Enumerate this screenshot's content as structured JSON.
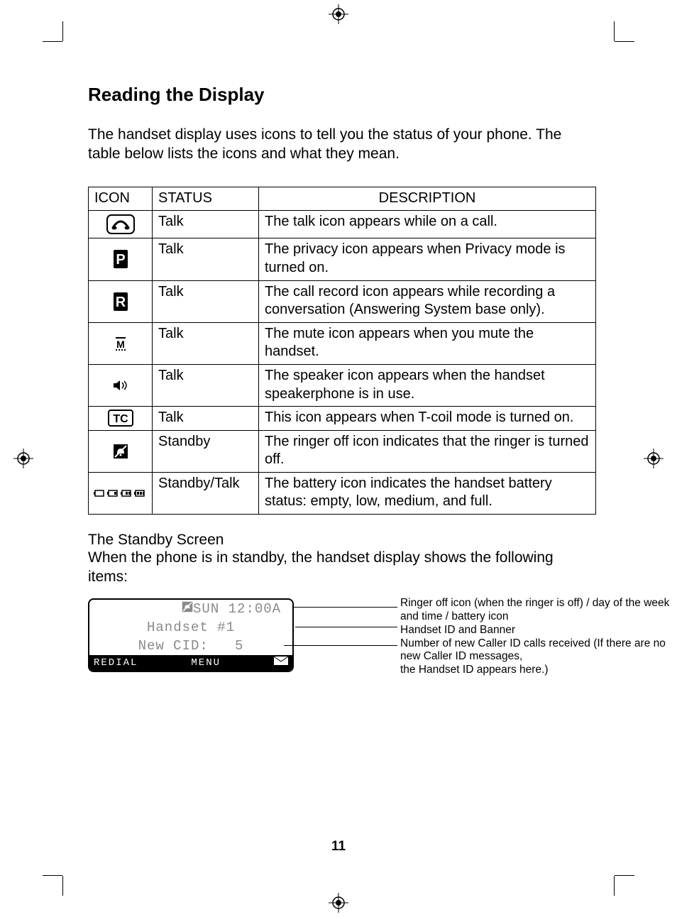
{
  "title": "Reading the Display",
  "intro": "The handset display uses icons to tell you the status of your phone. The table below lists the icons and what they mean.",
  "table": {
    "headers": [
      "ICON",
      "STATUS",
      "DESCRIPTION"
    ],
    "rows": [
      {
        "icon": "talk-phone-icon",
        "status": "Talk",
        "desc": "The talk icon appears while on a call."
      },
      {
        "icon": "privacy-p-icon",
        "status": "Talk",
        "desc": "The privacy icon appears when Privacy mode is turned on."
      },
      {
        "icon": "record-r-icon",
        "status": "Talk",
        "desc": "The call record icon appears while recording a conversation (Answering System base only)."
      },
      {
        "icon": "mute-m-icon",
        "status": "Talk",
        "desc": "The mute icon appears when you mute the handset."
      },
      {
        "icon": "speaker-icon",
        "status": "Talk",
        "desc": "The speaker icon appears when the handset speakerphone is in use."
      },
      {
        "icon": "tcoil-tc-icon",
        "status": "Talk",
        "desc": "This icon appears when T-coil mode is turned on."
      },
      {
        "icon": "ringer-off-icon",
        "status": "Standby",
        "desc": "The ringer off icon indicates that the ringer is turned off."
      },
      {
        "icon": "battery-levels-icon",
        "status": "Standby/Talk",
        "desc": "The battery icon indicates the handset battery status: empty, low, medium, and full."
      }
    ]
  },
  "standby": {
    "heading": "The Standby Screen",
    "intro": "When the phone is in standby, the handset display shows the following items:",
    "lcd": {
      "row1_mid": "SUN 12:00A",
      "row2": "Handset #1",
      "row3": "New CID:   5",
      "soft_left": "REDIAL",
      "soft_mid": "MENU"
    },
    "callouts": {
      "c1": "Ringer off icon (when the ringer is off) / day of the week and time / battery icon",
      "c2": "Handset ID and Banner",
      "c3": "Number of new Caller ID calls received (If there are no new Caller ID messages,",
      "c3b": "the Handset ID appears here.)"
    }
  },
  "page_number": "11"
}
